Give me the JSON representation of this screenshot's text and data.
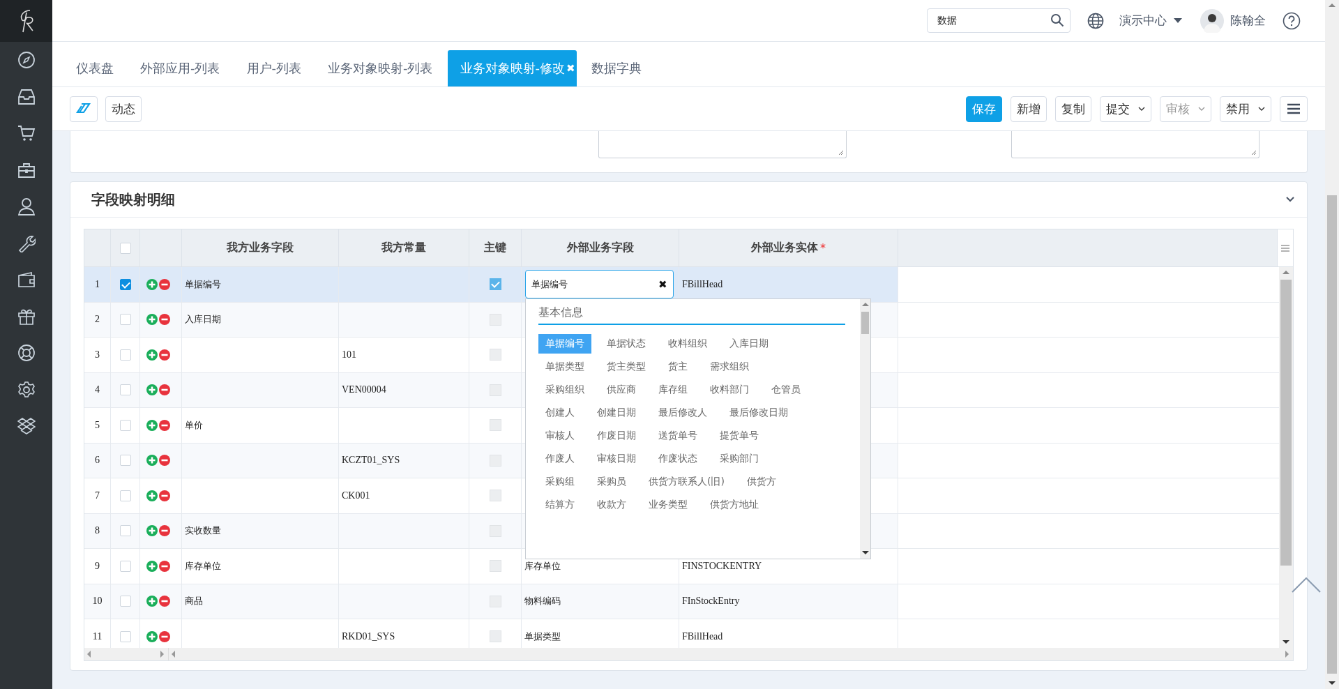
{
  "topbar": {
    "search": {
      "value": "数据"
    },
    "org": "演示中心",
    "user": "陈翰全"
  },
  "tabs": [
    {
      "label": "仪表盘",
      "selected": false
    },
    {
      "label": "外部应用-列表",
      "selected": false
    },
    {
      "label": "用户-列表",
      "selected": false
    },
    {
      "label": "业务对象映射-列表",
      "selected": false
    },
    {
      "label": "业务对象映射-修改",
      "selected": true,
      "close": "✖"
    },
    {
      "label": "数据字典",
      "selected": false
    }
  ],
  "toolbar": {
    "left": [
      {
        "kind": "icon"
      },
      {
        "kind": "text",
        "label": "动态"
      }
    ],
    "right": [
      {
        "kind": "primary",
        "label": "保存",
        "disabled": false
      },
      {
        "kind": "plain",
        "label": "新增",
        "disabled": false
      },
      {
        "kind": "plain",
        "label": "复制",
        "disabled": false
      },
      {
        "kind": "dropdown",
        "label": "提交",
        "disabled": false
      },
      {
        "kind": "dropdown",
        "label": "审核",
        "disabled": true
      },
      {
        "kind": "dropdown",
        "label": "禁用",
        "disabled": false
      },
      {
        "kind": "menu"
      }
    ]
  },
  "section": {
    "title": "字段映射明细"
  },
  "table": {
    "all_checked": false,
    "columns": [
      {
        "label": "我方业务字段",
        "required": false
      },
      {
        "label": "我方常量",
        "required": false
      },
      {
        "label": "主键",
        "required": false
      },
      {
        "label": "外部业务字段",
        "required": false
      },
      {
        "label": "外部业务实体",
        "required": true,
        "required_mark": "*"
      }
    ],
    "rows": [
      {
        "no": "1",
        "checked": true,
        "selected": true,
        "our_field": "单据编号",
        "primary_key": true,
        "ext_field_input": "单据编号",
        "clear": "✖",
        "ext_entity": "FBillHead"
      },
      {
        "no": "2",
        "checked": false,
        "selected": false,
        "our_field": "入库日期",
        "primary_key": false
      },
      {
        "no": "3",
        "checked": false,
        "selected": false,
        "our_constant": "101",
        "primary_key": false
      },
      {
        "no": "4",
        "checked": false,
        "selected": false,
        "our_constant": "VEN00004",
        "primary_key": false
      },
      {
        "no": "5",
        "checked": false,
        "selected": false,
        "our_field": "单价",
        "primary_key": false
      },
      {
        "no": "6",
        "checked": false,
        "selected": false,
        "our_constant": "KCZT01_SYS",
        "primary_key": false
      },
      {
        "no": "7",
        "checked": false,
        "selected": false,
        "our_constant": "CK001",
        "primary_key": false
      },
      {
        "no": "8",
        "checked": false,
        "selected": false,
        "our_field": "实收数量",
        "primary_key": false
      },
      {
        "no": "9",
        "checked": false,
        "selected": false,
        "our_field": "库存单位",
        "primary_key": false,
        "ext_field": "库存单位",
        "ext_entity": "FINSTOCKENTRY"
      },
      {
        "no": "10",
        "checked": false,
        "selected": false,
        "our_field": "商品",
        "primary_key": false,
        "ext_field": "物料编码",
        "ext_entity": "FInStockEntry"
      },
      {
        "no": "11",
        "checked": false,
        "selected": false,
        "our_constant": "RKD01_SYS",
        "primary_key": false,
        "ext_field": "单据类型",
        "ext_entity": "FBillHead"
      }
    ]
  },
  "dropdown": {
    "group": "基本信息",
    "option_rows": [
      [
        {
          "label": "单据编号",
          "selected": true
        },
        {
          "label": "单据状态",
          "selected": false
        },
        {
          "label": "收料组织",
          "selected": false
        },
        {
          "label": "入库日期",
          "selected": false
        }
      ],
      [
        {
          "label": "单据类型",
          "selected": false
        },
        {
          "label": "货主类型",
          "selected": false
        },
        {
          "label": "货主",
          "selected": false
        },
        {
          "label": "需求组织",
          "selected": false
        }
      ],
      [
        {
          "label": "采购组织",
          "selected": false
        },
        {
          "label": "供应商",
          "selected": false
        },
        {
          "label": "库存组",
          "selected": false
        },
        {
          "label": "收料部门",
          "selected": false
        },
        {
          "label": "仓管员",
          "selected": false
        }
      ],
      [
        {
          "label": "创建人",
          "selected": false
        },
        {
          "label": "创建日期",
          "selected": false
        },
        {
          "label": "最后修改人",
          "selected": false
        },
        {
          "label": "最后修改日期",
          "selected": false
        }
      ],
      [
        {
          "label": "审核人",
          "selected": false
        },
        {
          "label": "作废日期",
          "selected": false
        },
        {
          "label": "送货单号",
          "selected": false
        },
        {
          "label": "提货单号",
          "selected": false
        }
      ],
      [
        {
          "label": "作废人",
          "selected": false
        },
        {
          "label": "审核日期",
          "selected": false
        },
        {
          "label": "作废状态",
          "selected": false
        },
        {
          "label": "采购部门",
          "selected": false
        }
      ],
      [
        {
          "label": "采购组",
          "selected": false
        },
        {
          "label": "采购员",
          "selected": false
        },
        {
          "label": "供货方联系人(旧)",
          "selected": false
        },
        {
          "label": "供货方",
          "selected": false
        }
      ],
      [
        {
          "label": "结算方",
          "selected": false
        },
        {
          "label": "收款方",
          "selected": false
        },
        {
          "label": "业务类型",
          "selected": false
        },
        {
          "label": "供货方地址",
          "selected": false
        }
      ]
    ]
  }
}
